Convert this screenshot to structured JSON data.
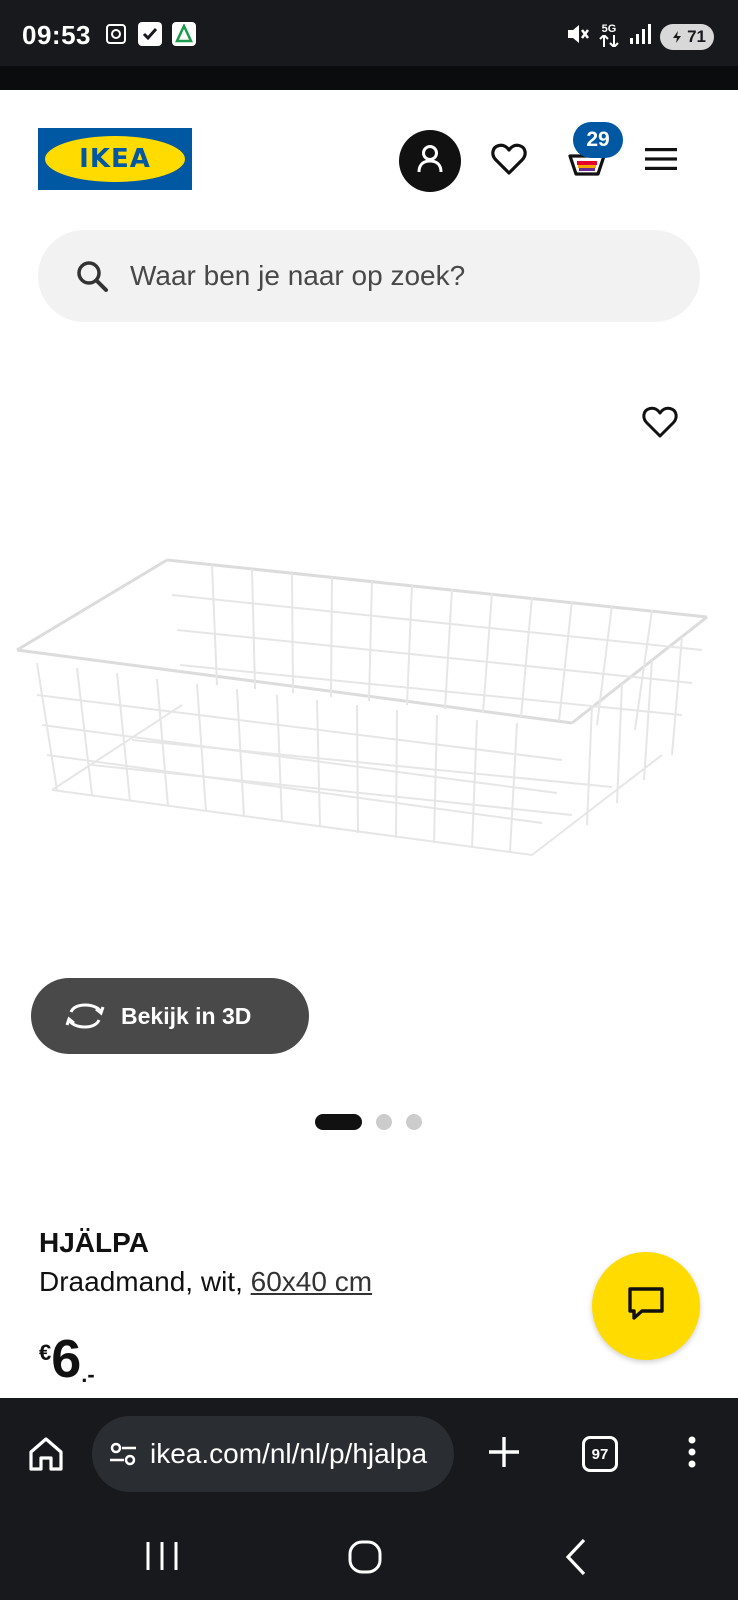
{
  "status_bar": {
    "time": "09:53",
    "battery": "71",
    "network": "5G"
  },
  "header": {
    "logo_text": "IKEA",
    "cart_count": "29"
  },
  "search": {
    "placeholder": "Waar ben je naar op zoek?"
  },
  "product": {
    "view_3d_label": "Bekijk in 3D",
    "carousel": {
      "total": 3,
      "active": 1
    },
    "name": "HJÄLPA",
    "description_prefix": "Draadmand, wit, ",
    "size": "60x40 cm",
    "price_currency": "€",
    "price_amount": "6",
    "price_suffix": ".-"
  },
  "browser": {
    "url": "ikea.com/nl/nl/p/hjalpa",
    "tab_count": "97"
  },
  "colors": {
    "ikea_blue": "#0058a3",
    "ikea_yellow": "#ffdb00",
    "dark_bar": "#17191c"
  }
}
